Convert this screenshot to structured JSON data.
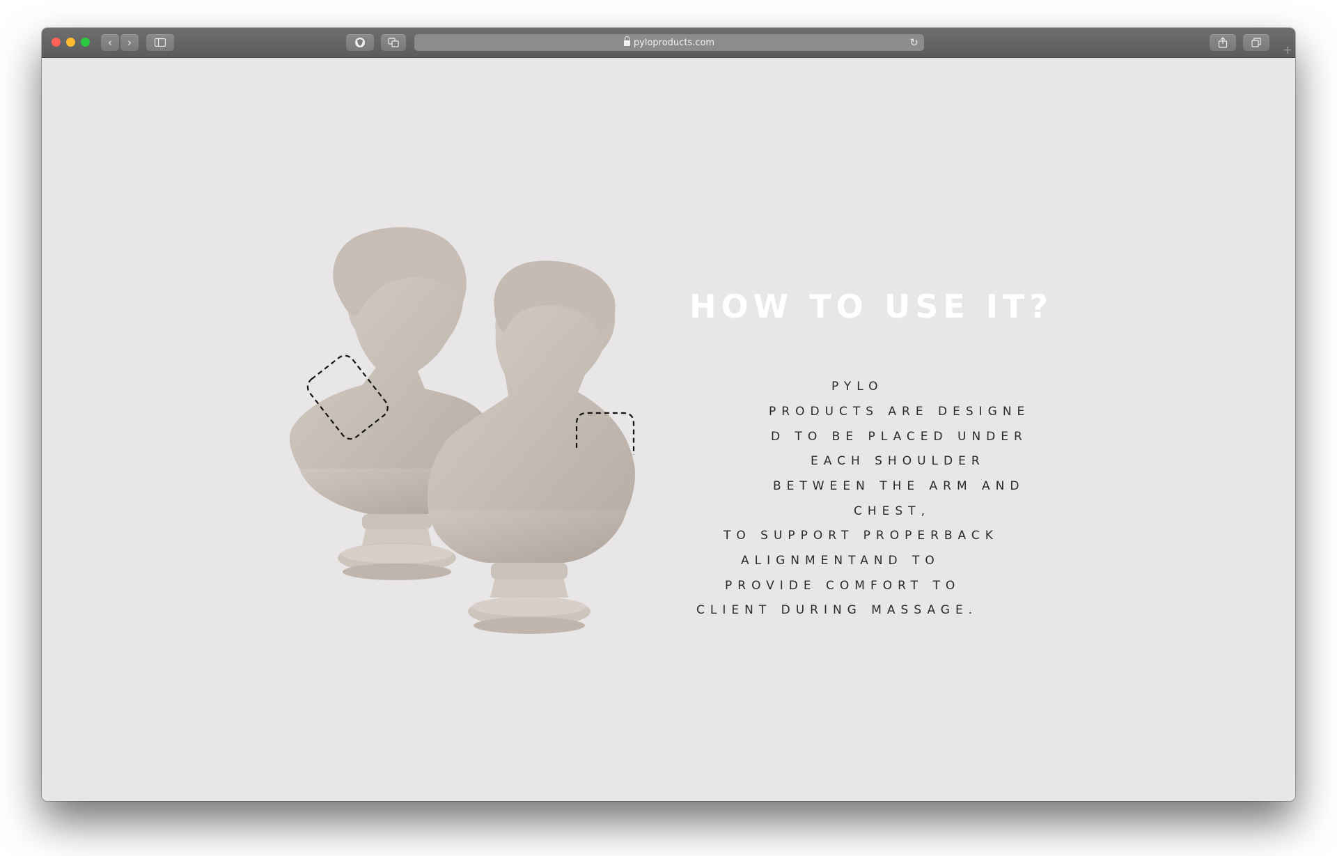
{
  "browser": {
    "url": "pyloproducts.com",
    "icons": {
      "back": "chevron-left-icon",
      "forward": "chevron-right-icon",
      "sidebar": "sidebar-icon",
      "privacy": "shield-icon",
      "translate": "translate-icon",
      "reload": "reload-icon",
      "share": "share-icon",
      "tabs": "tabs-icon",
      "new_tab": "plus-icon"
    },
    "colors": {
      "close": "#fe5f57",
      "minimize": "#febc2e",
      "zoom": "#28c840"
    }
  },
  "page": {
    "background": "#e8e6e7",
    "heading": "HOW TO USE IT?",
    "body_lines": [
      "PYLO",
      "PRODUCTS ARE DESIGNE",
      "D TO BE PLACED UNDER",
      "EACH SHOULDER",
      "BETWEEN THE ARM AND",
      "CHEST,",
      "TO SUPPORT PROPERBACK",
      "ALIGNMENTAND TO",
      "PROVIDE COMFORT TO",
      "CLIENT DURING MASSAGE."
    ]
  }
}
